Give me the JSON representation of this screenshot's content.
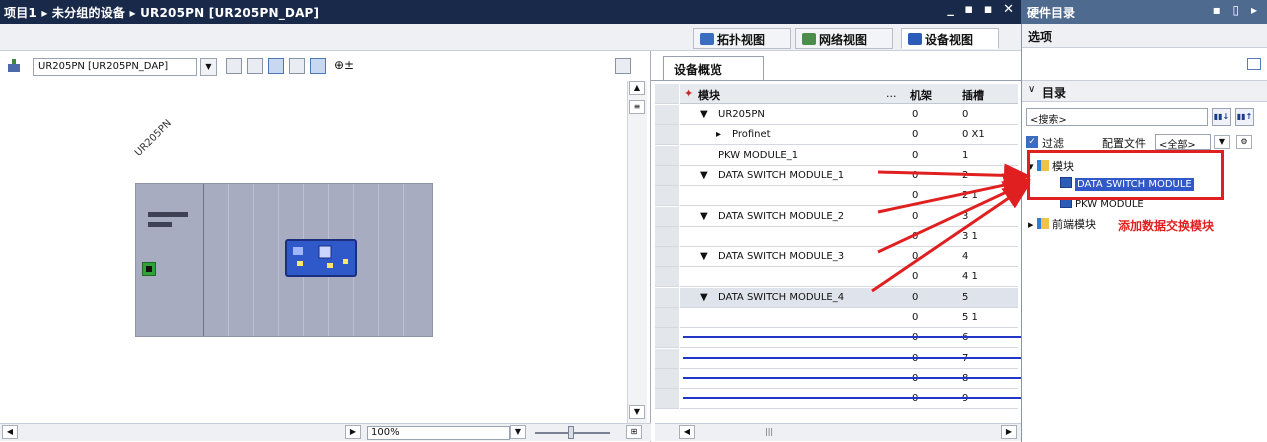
{
  "window": {
    "breadcrumb": "项目1 ▸ 未分组的设备 ▸ UR205PN [UR205PN_DAP]",
    "controls": "_ ▪ ▪ ✕"
  },
  "right_panel_title": {
    "title": "硬件目录",
    "controls": "▪ ▯ ▸"
  },
  "view_tabs": [
    {
      "label": "拓扑视图",
      "icon": "topology-icon",
      "active": false
    },
    {
      "label": "网络视图",
      "icon": "network-icon",
      "active": false
    },
    {
      "label": "设备视图",
      "icon": "device-icon",
      "active": true
    }
  ],
  "device_toolbar": {
    "device_select": "UR205PN [UR205PN_DAP]"
  },
  "device_graphic": {
    "device_label": "UR205PN"
  },
  "zoom": {
    "value": "100%"
  },
  "overview": {
    "tab_label": "设备概览",
    "columns": {
      "module": "模块",
      "ellipsis": "...",
      "rack": "机架",
      "slot": "插槽"
    },
    "rows": [
      {
        "expander": "▼",
        "name": "UR205PN",
        "rack": "0",
        "slot": "0",
        "selected": false
      },
      {
        "expander": "▸",
        "name": "Profinet",
        "rack": "0",
        "slot": "0 X1",
        "selected": false
      },
      {
        "expander": "",
        "name": "PKW MODULE_1",
        "rack": "0",
        "slot": "1",
        "selected": false
      },
      {
        "expander": "▼",
        "name": "DATA SWITCH MODULE_1",
        "rack": "0",
        "slot": "2",
        "selected": false
      },
      {
        "expander": "",
        "name": "",
        "rack": "0",
        "slot": "2 1",
        "selected": false
      },
      {
        "expander": "▼",
        "name": "DATA SWITCH MODULE_2",
        "rack": "0",
        "slot": "3",
        "selected": false
      },
      {
        "expander": "",
        "name": "",
        "rack": "0",
        "slot": "3 1",
        "selected": false
      },
      {
        "expander": "▼",
        "name": "DATA SWITCH MODULE_3",
        "rack": "0",
        "slot": "4",
        "selected": false
      },
      {
        "expander": "",
        "name": "",
        "rack": "0",
        "slot": "4 1",
        "selected": false
      },
      {
        "expander": "▼",
        "name": "DATA SWITCH MODULE_4",
        "rack": "0",
        "slot": "5",
        "selected": true
      },
      {
        "expander": "",
        "name": "",
        "rack": "0",
        "slot": "5 1",
        "selected": false
      },
      {
        "expander": "",
        "name": "",
        "rack": "0",
        "slot": "6",
        "selected": false
      },
      {
        "expander": "",
        "name": "",
        "rack": "0",
        "slot": "7",
        "selected": false
      },
      {
        "expander": "",
        "name": "",
        "rack": "0",
        "slot": "8",
        "selected": false
      },
      {
        "expander": "",
        "name": "",
        "rack": "0",
        "slot": "9",
        "selected": false
      }
    ]
  },
  "catalog": {
    "options_label": "选项",
    "catalog_label": "目录",
    "search_placeholder": "<搜索>",
    "filter_label": "过滤",
    "profile_label": "配置文件",
    "profile_value": "<全部>",
    "tree": {
      "modules_folder": "模块",
      "item_data_switch": "DATA SWITCH MODULE",
      "item_pkw": "PKW MODULE",
      "front_modules": "前端模块"
    },
    "annotation": "添加数据交换模块"
  },
  "colors": {
    "title_bar": "#19294a",
    "catalog_title": "#4e6a8e",
    "highlight_red": "#e02020",
    "rack_gray": "#a8acc0",
    "module_blue": "#2f58c8"
  }
}
